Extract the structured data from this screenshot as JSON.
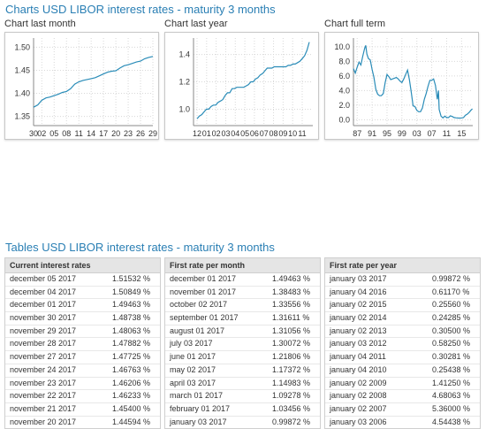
{
  "charts_title": "Charts USD LIBOR interest rates - maturity 3 months",
  "tables_title": "Tables USD LIBOR interest rates - maturity 3 months",
  "chart_data": [
    {
      "type": "line",
      "title": "Chart last month",
      "x": [
        "30",
        "01",
        "02",
        "03",
        "04",
        "05",
        "06",
        "07",
        "08",
        "09",
        "10",
        "11",
        "12",
        "13",
        "14",
        "15",
        "16",
        "17",
        "18",
        "19",
        "20",
        "21",
        "22",
        "23",
        "24",
        "25",
        "26",
        "27",
        "28",
        "29"
      ],
      "xticks": [
        "30",
        "02",
        "05",
        "08",
        "11",
        "14",
        "17",
        "20",
        "23",
        "26",
        "29"
      ],
      "values": [
        1.37,
        1.375,
        1.385,
        1.39,
        1.392,
        1.395,
        1.398,
        1.402,
        1.404,
        1.41,
        1.42,
        1.425,
        1.428,
        1.43,
        1.432,
        1.434,
        1.438,
        1.442,
        1.446,
        1.448,
        1.449,
        1.455,
        1.46,
        1.462,
        1.465,
        1.468,
        1.47,
        1.475,
        1.478,
        1.48
      ],
      "yticks": [
        1.35,
        1.4,
        1.45,
        1.5
      ],
      "ytick_labels": [
        "1.35",
        "1.40",
        "1.45",
        "1.50"
      ],
      "ylim": [
        1.33,
        1.52
      ],
      "color": "#2a8cb8"
    },
    {
      "type": "line",
      "title": "Chart last year",
      "x_count": 49,
      "xticks": [
        "12",
        "01",
        "02",
        "03",
        "04",
        "05",
        "06",
        "07",
        "08",
        "09",
        "10",
        "11"
      ],
      "values": [
        0.93,
        0.95,
        0.96,
        0.98,
        1.0,
        1.0,
        1.02,
        1.03,
        1.03,
        1.05,
        1.06,
        1.07,
        1.1,
        1.12,
        1.12,
        1.15,
        1.15,
        1.16,
        1.16,
        1.16,
        1.16,
        1.17,
        1.18,
        1.2,
        1.2,
        1.22,
        1.23,
        1.25,
        1.26,
        1.28,
        1.3,
        1.3,
        1.3,
        1.31,
        1.31,
        1.31,
        1.31,
        1.31,
        1.31,
        1.32,
        1.32,
        1.33,
        1.33,
        1.34,
        1.35,
        1.37,
        1.39,
        1.43,
        1.49
      ],
      "yticks": [
        1.0,
        1.2,
        1.4
      ],
      "ytick_labels": [
        "1.0",
        "1.2",
        "1.4"
      ],
      "ylim": [
        0.88,
        1.52
      ],
      "color": "#2a8cb8"
    },
    {
      "type": "line",
      "title": "Chart full term",
      "x_start": 1986,
      "x_end": 2017,
      "xticks": [
        "87",
        "91",
        "95",
        "99",
        "03",
        "07",
        "11",
        "15"
      ],
      "xtick_years": [
        1987,
        1991,
        1995,
        1999,
        2003,
        2007,
        2011,
        2015
      ],
      "points": [
        [
          1986,
          7.0
        ],
        [
          1986.5,
          6.4
        ],
        [
          1987,
          7.2
        ],
        [
          1987.5,
          7.9
        ],
        [
          1988,
          7.5
        ],
        [
          1988.5,
          8.7
        ],
        [
          1989,
          9.8
        ],
        [
          1989.3,
          10.2
        ],
        [
          1989.6,
          9.0
        ],
        [
          1990,
          8.4
        ],
        [
          1990.5,
          8.2
        ],
        [
          1991,
          6.9
        ],
        [
          1991.5,
          5.8
        ],
        [
          1992,
          4.2
        ],
        [
          1992.5,
          3.5
        ],
        [
          1993,
          3.3
        ],
        [
          1993.5,
          3.3
        ],
        [
          1994,
          3.6
        ],
        [
          1994.5,
          5.1
        ],
        [
          1995,
          6.2
        ],
        [
          1995.5,
          5.9
        ],
        [
          1996,
          5.5
        ],
        [
          1996.5,
          5.6
        ],
        [
          1997,
          5.7
        ],
        [
          1997.5,
          5.8
        ],
        [
          1998,
          5.6
        ],
        [
          1998.5,
          5.3
        ],
        [
          1999,
          5.1
        ],
        [
          1999.5,
          5.6
        ],
        [
          2000,
          6.2
        ],
        [
          2000.5,
          6.8
        ],
        [
          2001,
          5.5
        ],
        [
          2001.5,
          3.8
        ],
        [
          2002,
          1.9
        ],
        [
          2002.5,
          1.8
        ],
        [
          2003,
          1.3
        ],
        [
          2003.5,
          1.1
        ],
        [
          2004,
          1.1
        ],
        [
          2004.5,
          1.6
        ],
        [
          2005,
          2.8
        ],
        [
          2005.5,
          3.6
        ],
        [
          2006,
          4.6
        ],
        [
          2006.5,
          5.4
        ],
        [
          2007,
          5.4
        ],
        [
          2007.5,
          5.6
        ],
        [
          2008,
          4.7
        ],
        [
          2008.5,
          2.8
        ],
        [
          2008.8,
          4.0
        ],
        [
          2009,
          1.4
        ],
        [
          2009.5,
          0.5
        ],
        [
          2010,
          0.25
        ],
        [
          2010.5,
          0.5
        ],
        [
          2011,
          0.3
        ],
        [
          2011.5,
          0.3
        ],
        [
          2012,
          0.55
        ],
        [
          2012.5,
          0.45
        ],
        [
          2013,
          0.3
        ],
        [
          2013.5,
          0.27
        ],
        [
          2014,
          0.24
        ],
        [
          2014.5,
          0.23
        ],
        [
          2015,
          0.26
        ],
        [
          2015.5,
          0.29
        ],
        [
          2016,
          0.61
        ],
        [
          2016.5,
          0.75
        ],
        [
          2017,
          1.0
        ],
        [
          2017.5,
          1.3
        ],
        [
          2017.9,
          1.5
        ]
      ],
      "yticks": [
        0.0,
        2.0,
        4.0,
        6.0,
        8.0,
        10.0
      ],
      "ytick_labels": [
        "0.0",
        "2.0",
        "4.0",
        "6.0",
        "8.0",
        "10.0"
      ],
      "ylim": [
        -0.8,
        11.2
      ],
      "color": "#2a8cb8"
    }
  ],
  "tables": [
    {
      "header": "Current interest rates",
      "rows": [
        {
          "date": "december 05 2017",
          "value": "1.51532 %"
        },
        {
          "date": "december 04 2017",
          "value": "1.50849 %"
        },
        {
          "date": "december 01 2017",
          "value": "1.49463 %"
        },
        {
          "date": "november 30 2017",
          "value": "1.48738 %"
        },
        {
          "date": "november 29 2017",
          "value": "1.48063 %"
        },
        {
          "date": "november 28 2017",
          "value": "1.47882 %"
        },
        {
          "date": "november 27 2017",
          "value": "1.47725 %"
        },
        {
          "date": "november 24 2017",
          "value": "1.46763 %"
        },
        {
          "date": "november 23 2017",
          "value": "1.46206 %"
        },
        {
          "date": "november 22 2017",
          "value": "1.46233 %"
        },
        {
          "date": "november 21 2017",
          "value": "1.45400 %"
        },
        {
          "date": "november 20 2017",
          "value": "1.44594 %"
        }
      ]
    },
    {
      "header": "First rate per month",
      "rows": [
        {
          "date": "december 01 2017",
          "value": "1.49463 %"
        },
        {
          "date": "november 01 2017",
          "value": "1.38483 %"
        },
        {
          "date": "october 02 2017",
          "value": "1.33556 %"
        },
        {
          "date": "september 01 2017",
          "value": "1.31611 %"
        },
        {
          "date": "august 01 2017",
          "value": "1.31056 %"
        },
        {
          "date": "july 03 2017",
          "value": "1.30072 %"
        },
        {
          "date": "june 01 2017",
          "value": "1.21806 %"
        },
        {
          "date": "may 02 2017",
          "value": "1.17372 %"
        },
        {
          "date": "april 03 2017",
          "value": "1.14983 %"
        },
        {
          "date": "march 01 2017",
          "value": "1.09278 %"
        },
        {
          "date": "february 01 2017",
          "value": "1.03456 %"
        },
        {
          "date": "january 03 2017",
          "value": "0.99872 %"
        }
      ]
    },
    {
      "header": "First rate per year",
      "rows": [
        {
          "date": "january 03 2017",
          "value": "0.99872 %"
        },
        {
          "date": "january 04 2016",
          "value": "0.61170 %"
        },
        {
          "date": "january 02 2015",
          "value": "0.25560 %"
        },
        {
          "date": "january 02 2014",
          "value": "0.24285 %"
        },
        {
          "date": "january 02 2013",
          "value": "0.30500 %"
        },
        {
          "date": "january 03 2012",
          "value": "0.58250 %"
        },
        {
          "date": "january 04 2011",
          "value": "0.30281 %"
        },
        {
          "date": "january 04 2010",
          "value": "0.25438 %"
        },
        {
          "date": "january 02 2009",
          "value": "1.41250 %"
        },
        {
          "date": "january 02 2008",
          "value": "4.68063 %"
        },
        {
          "date": "january 02 2007",
          "value": "5.36000 %"
        },
        {
          "date": "january 03 2006",
          "value": "4.54438 %"
        }
      ]
    }
  ]
}
